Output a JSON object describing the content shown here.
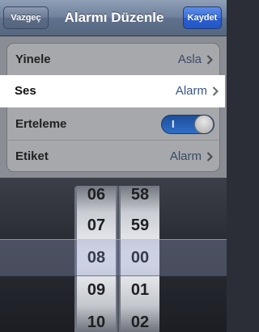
{
  "navbar": {
    "cancel_label": "Vazgeç",
    "title": "Alarmı Düzenle",
    "save_label": "Kaydet"
  },
  "settings": {
    "rows": [
      {
        "label": "Yinele",
        "value": "Asla"
      },
      {
        "label": "Ses",
        "value": "Alarm"
      },
      {
        "label": "Erteleme",
        "toggle_text": "I",
        "toggle_on": true
      },
      {
        "label": "Etiket",
        "value": "Alarm"
      }
    ]
  },
  "picker": {
    "hours": [
      "06",
      "07",
      "08",
      "09",
      "10"
    ],
    "minutes": [
      "58",
      "59",
      "00",
      "01",
      "02"
    ],
    "selected_hour": "08",
    "selected_minute": "00"
  },
  "colors": {
    "accent": "#2b5fcf",
    "value_text": "#385487",
    "toggle_on": "#2e6ec9"
  }
}
